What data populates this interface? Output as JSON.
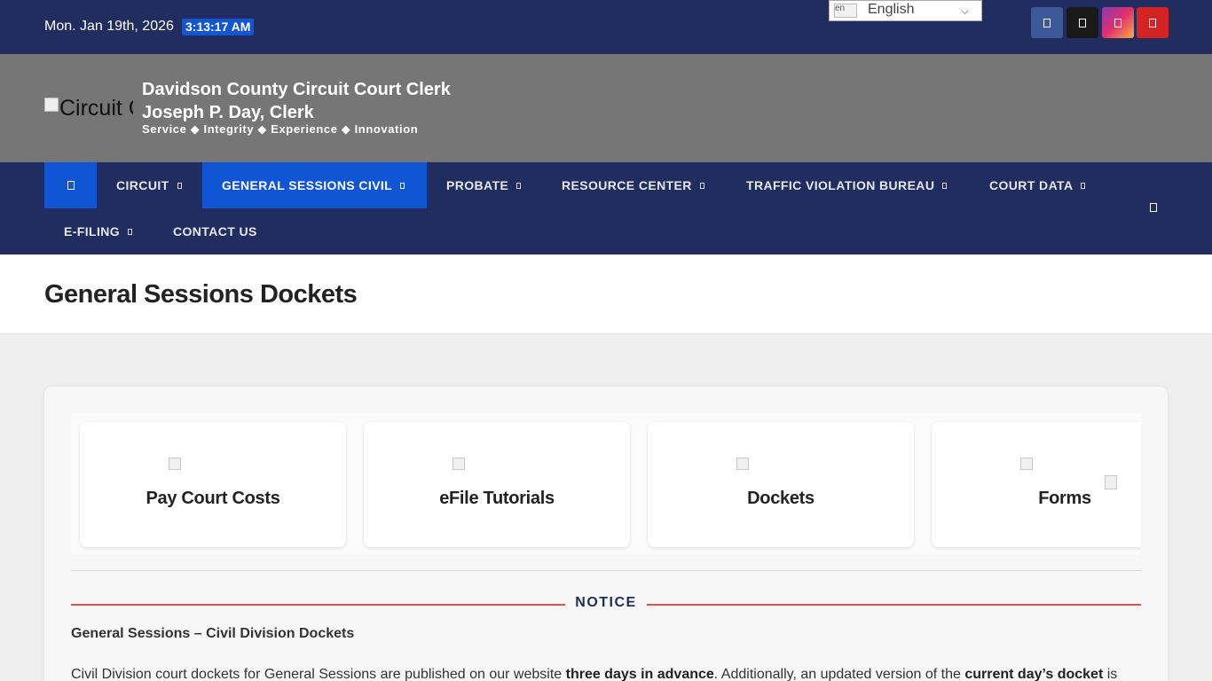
{
  "topbar": {
    "date": "Mon. Jan 19th, 2026",
    "time": "3:13:17 AM",
    "language": {
      "flag_alt": "en",
      "label": "English"
    },
    "social": [
      {
        "name": "facebook-icon",
        "color": "#3b5998"
      },
      {
        "name": "x-twitter-icon",
        "color": "#1a1a1a"
      },
      {
        "name": "instagram-icon",
        "color": "#e1306c"
      },
      {
        "name": "youtube-icon",
        "color": "#d32323"
      }
    ]
  },
  "header": {
    "logo_alt": "Circuit C",
    "title": "Davidson County Circuit Court Clerk",
    "subtitle": "Joseph P. Day, Clerk",
    "tagline": "Service ◆ Integrity ◆ Experience ◆ Innovation"
  },
  "nav": {
    "items": [
      {
        "label": "CIRCUIT"
      },
      {
        "label": "GENERAL SESSIONS CIVIL"
      },
      {
        "label": "PROBATE"
      },
      {
        "label": "RESOURCE CENTER"
      },
      {
        "label": "TRAFFIC VIOLATION BUREAU"
      },
      {
        "label": "COURT DATA"
      },
      {
        "label": "E-FILING"
      },
      {
        "label": "CONTACT US"
      }
    ],
    "active": "GENERAL SESSIONS CIVIL"
  },
  "page": {
    "title": "General Sessions Dockets"
  },
  "tiles": [
    {
      "label": "Pay Court Costs"
    },
    {
      "label": "eFile Tutorials"
    },
    {
      "label": "Dockets"
    },
    {
      "label": "Forms"
    }
  ],
  "notice": {
    "label": "NOTICE",
    "subhead": "General Sessions – Civil Division Dockets",
    "para_start": "Civil Division court dockets for General Sessions are published on our website ",
    "para_bold1": "three days in advance",
    "para_mid": ". Additionally, an updated version of the ",
    "para_bold2": "current day’s docket",
    "para_end": " is"
  },
  "colors": {
    "navy": "#202d5e",
    "accent_blue": "#1055d4",
    "header_gray": "#767676",
    "notice_red": "#e05252"
  }
}
